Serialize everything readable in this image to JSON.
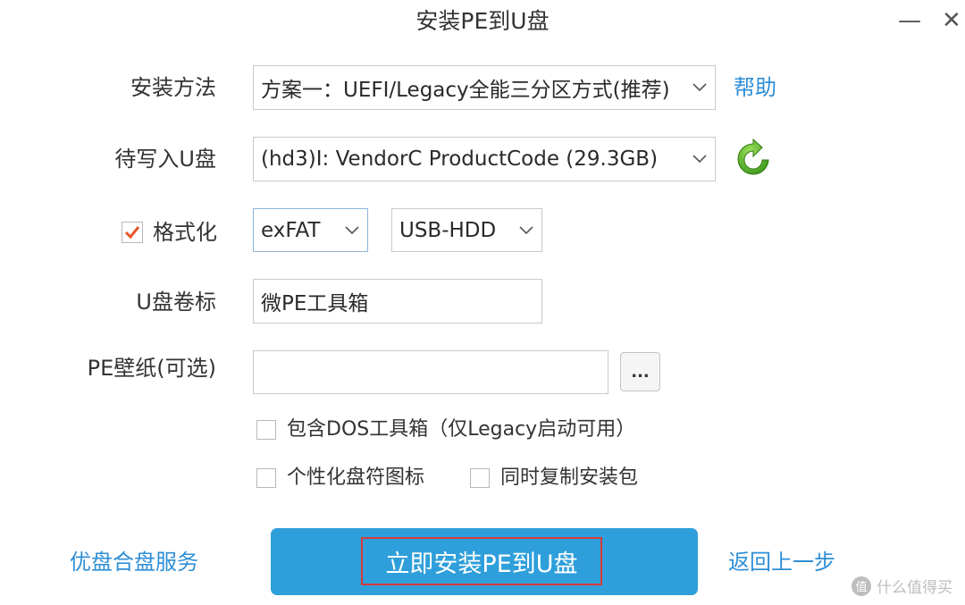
{
  "window": {
    "title": "安装PE到U盘",
    "minimize_glyph": "—",
    "close_glyph": "✕"
  },
  "install_method": {
    "label": "安装方法",
    "value": "方案一：UEFI/Legacy全能三分区方式(推荐)",
    "help_link": "帮助"
  },
  "target_disk": {
    "label": "待写入U盘",
    "value": "(hd3)I: VendorC ProductCode (29.3GB)",
    "refresh_icon": "refresh-icon"
  },
  "format": {
    "label": "格式化",
    "checked": true,
    "filesystem": "exFAT",
    "mode": "USB-HDD"
  },
  "volume_label": {
    "label": "U盘卷标",
    "value": "微PE工具箱"
  },
  "wallpaper": {
    "label": "PE壁纸(可选)",
    "value": "",
    "browse_label": "..."
  },
  "options": {
    "dos_tools": {
      "label": "包含DOS工具箱（仅Legacy启动可用）",
      "checked": false
    },
    "custom_icon": {
      "label": "个性化盘符图标",
      "checked": false
    },
    "copy_package": {
      "label": "同时复制安装包",
      "checked": false
    }
  },
  "footer": {
    "left_link": "优盘合盘服务",
    "primary_button": "立即安装PE到U盘",
    "back_link": "返回上一步"
  },
  "watermark": {
    "badge": "值",
    "text": "什么值得买"
  },
  "colors": {
    "accent": "#2f9fdb",
    "link": "#2f8fd6",
    "highlight_border": "#d73a3a",
    "check": "#e8562a",
    "refresh": "#5cb82a"
  }
}
